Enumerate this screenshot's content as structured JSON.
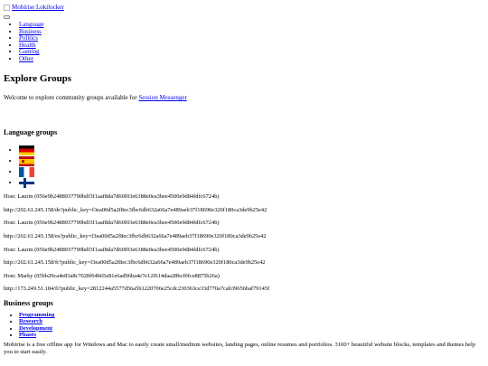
{
  "header": {
    "brand_alt": "Mobirise Lokilocker"
  },
  "nav": {
    "items": [
      "Language",
      "Business",
      "Politics",
      "Health",
      "Gaming",
      "Other"
    ]
  },
  "main": {
    "title": "Explore Groups",
    "intro_text": "Welcome to explore community groups available for",
    "intro_link": "Session Messenger"
  },
  "language_groups": {
    "heading": "Language groups",
    "flags": [
      {
        "icon": "flag-germany-icon"
      },
      {
        "icon": "flag-spain-icon"
      },
      {
        "icon": "flag-france-icon"
      },
      {
        "icon": "flag-finland-icon"
      }
    ]
  },
  "hosts": [
    "Host: Laurin (056e9b2488937790bdf3f1aaf8da7d60f03e6388e0ea3bee4500e9d84fdfc6724b)",
    "http://202.61.245.158/de?public_key=f3ea00d5a2f8ec3fbc6db632a66a7e489aeb37f18690e320f180ca3de9b25e42",
    "Host: Laurin (056e9b2488937790bdf3f1aaf8da7d60f03e6388e0ea3bee4500e9d84fdfc6724b)",
    "http://202.61.245.158/es?public_key=f3ea00d5a2f8ec3fbc6db632a66a7e489aeb37f18690e320f180ca3de9b25e42",
    "Host: Laurin (056e9b2488937790bdf3f1aaf8da7d60f03e6388e0ea3bee4500e9d84fdfc6724b)",
    "http://202.61.245.158/fr?public_key=f3ea00d5a2f8ec3fbc6db632a66a7e489aeb37f18690e320f180ca3de9b25e42",
    "Host: Marky (05bb29ca4e83a8c7028f64b65e81e6ad96ba4e7e12f614daa28bcf0fce8875b26a)",
    "http://173.249.51.184/fi?public_key=2812244a5577d56a5b1220706e25cdc230363ce33d770a7cab39656baf79145f"
  ],
  "business_groups": {
    "heading": "Business groups",
    "items": [
      "Programming",
      "Research",
      "Development",
      "Phases"
    ]
  },
  "footer": {
    "text": "Mobirise is a free offline app for Windows and Mac to easily create small/medium websites, landing pages, online resumes and portfolios. 3100+ beautiful website blocks, templates and themes help you to start easily."
  }
}
